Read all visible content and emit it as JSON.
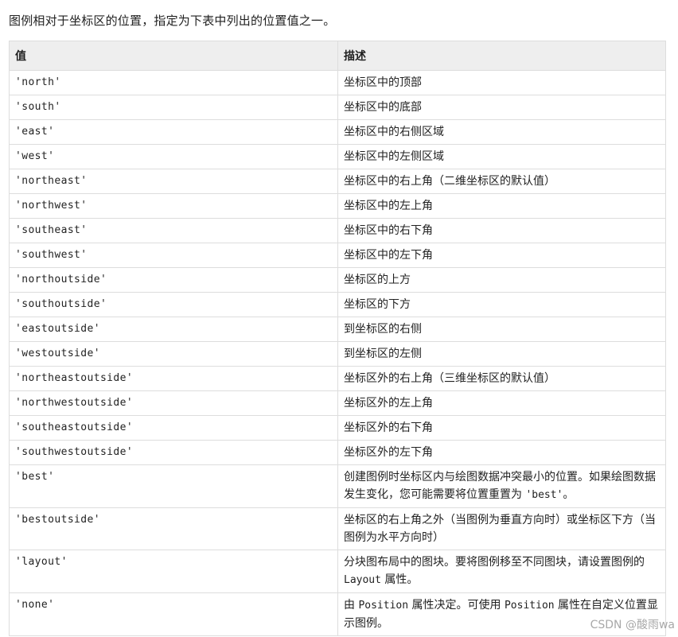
{
  "intro": "图例相对于坐标区的位置，指定为下表中列出的位置值之一。",
  "table": {
    "headers": [
      "值",
      "描述"
    ],
    "rows": [
      {
        "value": "'north'",
        "desc": "坐标区中的顶部"
      },
      {
        "value": "'south'",
        "desc": "坐标区中的底部"
      },
      {
        "value": "'east'",
        "desc": "坐标区中的右侧区域"
      },
      {
        "value": "'west'",
        "desc": "坐标区中的左侧区域"
      },
      {
        "value": "'northeast'",
        "desc": "坐标区中的右上角（二维坐标区的默认值）"
      },
      {
        "value": "'northwest'",
        "desc": "坐标区中的左上角"
      },
      {
        "value": "'southeast'",
        "desc": "坐标区中的右下角"
      },
      {
        "value": "'southwest'",
        "desc": "坐标区中的左下角"
      },
      {
        "value": "'northoutside'",
        "desc": "坐标区的上方"
      },
      {
        "value": "'southoutside'",
        "desc": "坐标区的下方"
      },
      {
        "value": "'eastoutside'",
        "desc": "到坐标区的右侧"
      },
      {
        "value": "'westoutside'",
        "desc": "到坐标区的左侧"
      },
      {
        "value": "'northeastoutside'",
        "desc": "坐标区外的右上角（三维坐标区的默认值）"
      },
      {
        "value": "'northwestoutside'",
        "desc": "坐标区外的左上角"
      },
      {
        "value": "'southeastoutside'",
        "desc": "坐标区外的右下角"
      },
      {
        "value": "'southwestoutside'",
        "desc": "坐标区外的左下角"
      },
      {
        "value": "'best'",
        "desc_parts": [
          "创建图例时坐标区内与绘图数据冲突最小的位置。如果绘图数据发生变化，您可能需要将位置重置为 ",
          "'best'",
          "。"
        ]
      },
      {
        "value": "'bestoutside'",
        "desc": "坐标区的右上角之外（当图例为垂直方向时）或坐标区下方（当图例为水平方向时）"
      },
      {
        "value": "'layout'",
        "desc_parts": [
          "分块图布局中的图块。要将图例移至不同图块，请设置图例的 ",
          "Layout",
          " 属性。"
        ]
      },
      {
        "value": "'none'",
        "desc_parts": [
          "由 ",
          "Position",
          " 属性决定。可使用 ",
          "Position",
          " 属性在自定义位置显示图例。"
        ]
      }
    ]
  },
  "watermark": "CSDN @酸雨wa"
}
